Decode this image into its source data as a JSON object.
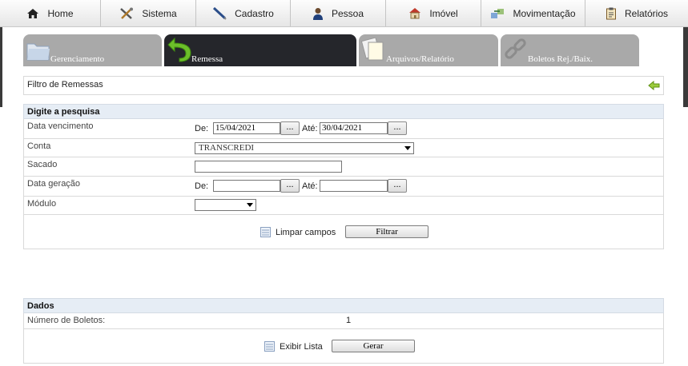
{
  "menu": {
    "items": [
      {
        "label": "Home",
        "icon": "home-icon"
      },
      {
        "label": "Sistema",
        "icon": "tools-icon"
      },
      {
        "label": "Cadastro",
        "icon": "pen-icon"
      },
      {
        "label": "Pessoa",
        "icon": "person-icon"
      },
      {
        "label": "Imóvel",
        "icon": "house-icon"
      },
      {
        "label": "Movimentação",
        "icon": "transfer-icon"
      },
      {
        "label": "Relatórios",
        "icon": "clipboard-icon"
      }
    ]
  },
  "tabs": [
    {
      "label": "Gerenciamento",
      "icon": "folder-icon",
      "active": false
    },
    {
      "label": "Remessa",
      "icon": "return-arrow-icon",
      "active": true
    },
    {
      "label": "Arquivos/Relatório",
      "icon": "documents-icon",
      "active": false
    },
    {
      "label": "Boletos Rej./Baix.",
      "icon": "chain-icon",
      "active": false
    }
  ],
  "filter_title": "Filtro de Remessas",
  "search": {
    "heading": "Digite a pesquisa",
    "data_vencimento": {
      "label": "Data vencimento",
      "de_label": "De:",
      "de_value": "15/04/2021",
      "ate_label": "Até:",
      "ate_value": "30/04/2021",
      "picker": "..."
    },
    "conta": {
      "label": "Conta",
      "value": "TRANSCREDI"
    },
    "sacado": {
      "label": "Sacado",
      "value": ""
    },
    "data_geracao": {
      "label": "Data geração",
      "de_label": "De:",
      "de_value": "",
      "ate_label": "Até:",
      "ate_value": "",
      "picker": "..."
    },
    "modulo": {
      "label": "Módulo",
      "value": ""
    },
    "clear_label": "Limpar campos",
    "filter_button": "Filtrar"
  },
  "dados": {
    "heading": "Dados",
    "num_boletos_label": "Número de Boletos:",
    "num_boletos_value": "1",
    "show_list_label": "Exibir Lista",
    "generate_button": "Gerar"
  },
  "colors": {
    "accent_tab": "#25262b",
    "inactive_tab": "#a9a9a9",
    "section_header": "#e6edf5"
  }
}
